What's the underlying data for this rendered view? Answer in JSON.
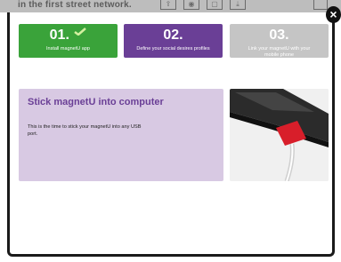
{
  "background": {
    "text": "in the first street network."
  },
  "close": {
    "label": "×"
  },
  "steps": [
    {
      "num": "01.",
      "desc": "Install magnetU app"
    },
    {
      "num": "02.",
      "desc": "Define your social desires profiles"
    },
    {
      "num": "03.",
      "desc": "Link your magnetU with your mobile phone"
    }
  ],
  "info": {
    "title": "Stick magnetU into computer",
    "text": "This is the time to stick your magnetU into any USB port."
  },
  "colors": {
    "green": "#3aa33a",
    "purple": "#6a3f96",
    "grey": "#c5c5c5",
    "lavender": "#d8c9e3"
  }
}
